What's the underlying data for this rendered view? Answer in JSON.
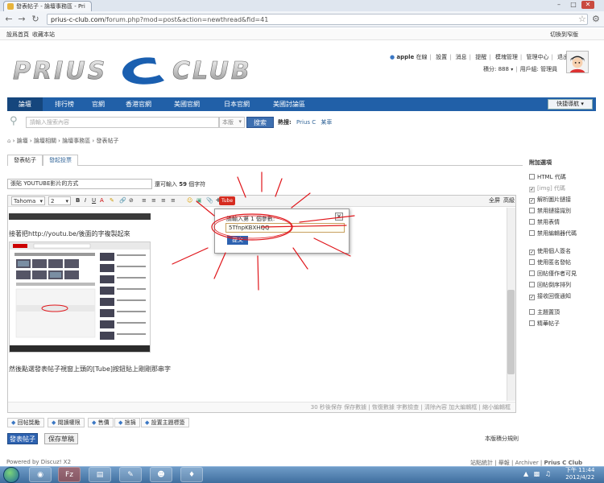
{
  "browser": {
    "tab_title": "發表帖子 - 論壇事務區 - Pri",
    "url_host": "prius-c-club.com",
    "url_path": "/forum.php?mod=post&action=newthread&fid=41",
    "back_icon": "back-arrow-icon",
    "forward_icon": "forward-arrow-icon",
    "reload_icon": "reload-icon"
  },
  "topbar": {
    "left_links": [
      "設爲首頁",
      "收藏本站"
    ],
    "right_link": "切換到窄版"
  },
  "site": {
    "logo_text": "PRIUS C CLUB"
  },
  "user": {
    "nav": [
      "apple",
      "在線",
      "設置",
      "消息",
      "提醒",
      "模塊管理",
      "管理中心",
      "退出"
    ],
    "points": "積分: 888",
    "group": "用戶組: 管理員"
  },
  "mainnav": {
    "items": [
      "論壇",
      "排行榜",
      "官網",
      "香港官網",
      "美國官網",
      "日本官網",
      "美國討論區"
    ],
    "quicknav": "快捷導航"
  },
  "search": {
    "placeholder": "請輸入搜索內容",
    "scope": "本版",
    "button": "搜索",
    "hot_label": "熱搜:",
    "hot_terms": [
      "Prius C",
      "某車"
    ]
  },
  "breadcrumb": [
    "論壇",
    "論壇相關",
    "論壇事務區",
    "發表帖子"
  ],
  "post": {
    "tabs": [
      "發表帖子",
      "發起投票"
    ],
    "title_value": "張貼 YOUTUBE影片的方式",
    "title_hint_pre": "還可輸入",
    "title_hint_count": "59",
    "title_hint_post": "個字符"
  },
  "editor": {
    "font": "Tahoma",
    "size": "2",
    "fullscreen": "全屏",
    "advanced": "高級",
    "body_line1": "接著把http://youtu.be/後面的字複製起來",
    "body_line2": "然後點選發表帖子視窗上頭的[Tube]按鈕貼上剛剛那串字",
    "footer": "30 秒後保存 保存數據 | 恢復數據   字數檢查 | 清除內容   加大編輯框 | 縮小編輯框",
    "toolbar_tube": "Tube"
  },
  "popup": {
    "label": "請輸入第 1 個參數:",
    "value": "5TfnpKBXHQQ",
    "submit": "提交",
    "close": "×"
  },
  "actions": [
    "回帖獎勵",
    "閱讀權限",
    "售價",
    "捨捐",
    "設置主題標簽"
  ],
  "buttons": {
    "post": "發表帖子",
    "draft": "保存草稿",
    "rules": "本版積分規則"
  },
  "sidebar": {
    "title": "附加選項",
    "options": [
      {
        "label": "HTML 代碼",
        "checked": false,
        "disabled": false
      },
      {
        "label": "[img] 代碼",
        "checked": true,
        "disabled": true
      },
      {
        "label": "解析圖片鏈接",
        "checked": true,
        "disabled": false
      },
      {
        "label": "禁用鏈接識別",
        "checked": false,
        "disabled": false
      },
      {
        "label": "禁用表情",
        "checked": false,
        "disabled": false
      },
      {
        "label": "禁用編輯器代碼",
        "checked": false,
        "disabled": false
      },
      {
        "label": "使用個人簽名",
        "checked": true,
        "disabled": false
      },
      {
        "label": "使用匿名發帖",
        "checked": false,
        "disabled": false
      },
      {
        "label": "回帖僅作者可見",
        "checked": false,
        "disabled": false
      },
      {
        "label": "回帖倒序排列",
        "checked": false,
        "disabled": false
      },
      {
        "label": "接收回復通知",
        "checked": true,
        "disabled": false
      },
      {
        "label": "主題置頂",
        "checked": false,
        "disabled": false
      },
      {
        "label": "精華帖子",
        "checked": false,
        "disabled": false
      }
    ]
  },
  "footer": {
    "left": "Powered by Discuz! X2",
    "right": [
      "站點統計",
      "舉報",
      "Archiver",
      "Prius C Club"
    ]
  },
  "taskbar": {
    "time": "下午 11:44",
    "date": "2012/4/22"
  },
  "colors": {
    "nav_blue": "#2160a8",
    "button_blue": "#2d62b0",
    "annotation_red": "#e0161b"
  }
}
